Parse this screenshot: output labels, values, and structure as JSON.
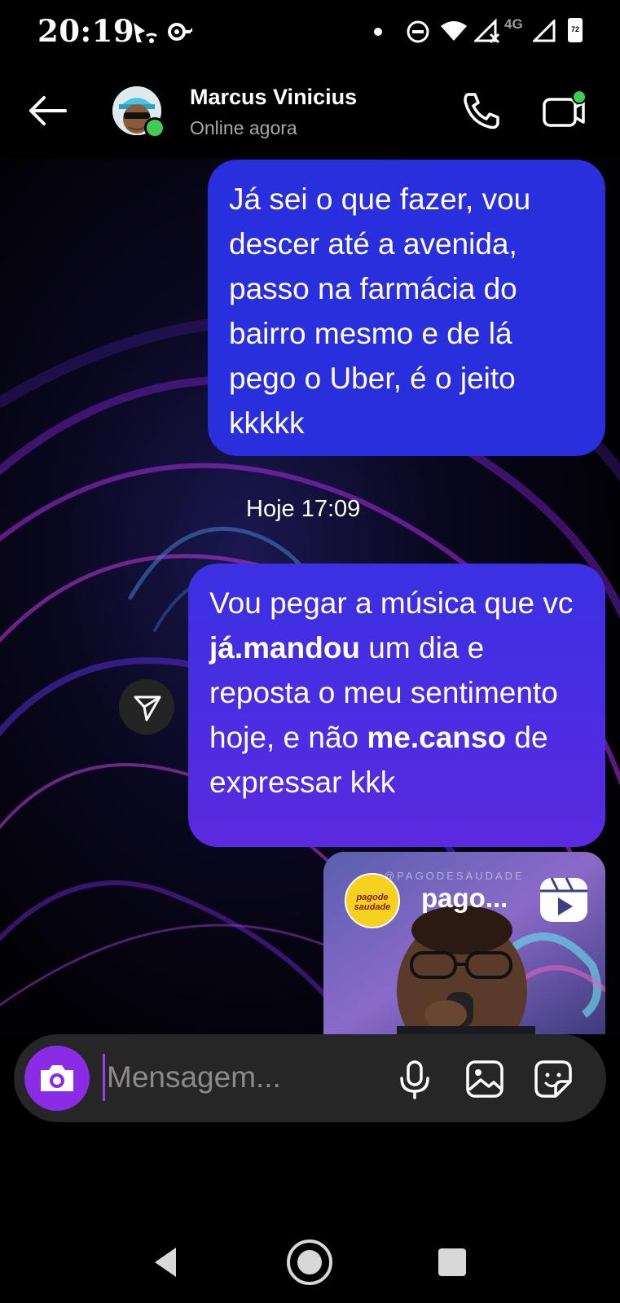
{
  "status_bar": {
    "time": "20:19",
    "network": "4G",
    "battery": "72",
    "icons": [
      "media-cast-icon",
      "vpn-key-icon",
      "notification-dot-icon",
      "do-not-disturb-icon",
      "wifi-icon",
      "signal-no-data-icon",
      "signal-icon",
      "battery-icon"
    ]
  },
  "header": {
    "contact_name": "Marcus Vinicius",
    "status": "Online agora",
    "icons": [
      "back-arrow-icon",
      "phone-icon",
      "video-call-icon"
    ]
  },
  "messages": [
    {
      "type": "sent",
      "segments": [
        {
          "text": "Já sei o que fazer, vou descer até a avenida, passo na farmácia do bairro mesmo e de lá pego o Uber, é o jeito kkkkk",
          "bold": false
        }
      ]
    },
    {
      "type": "timestamp",
      "text": "Hoje 17:09"
    },
    {
      "type": "sent",
      "segments": [
        {
          "text": "Vou pegar a música que vc ",
          "bold": false
        },
        {
          "text": "já.mandou",
          "bold": true
        },
        {
          "text": " um dia e reposta o meu sentimento hoje, e não ",
          "bold": false
        },
        {
          "text": "me.canso",
          "bold": true
        },
        {
          "text": " de expressar kkk",
          "bold": false
        }
      ]
    },
    {
      "type": "shared_reel",
      "handle": "@PAGODESAUDADE",
      "title": "pago...",
      "logo_text": "pagode saudade"
    }
  ],
  "composer": {
    "placeholder": "Mensagem...",
    "value": "",
    "icons": [
      "camera-icon",
      "microphone-icon",
      "gallery-icon",
      "sticker-icon"
    ]
  },
  "colors": {
    "bubble_blue": "#2a2fdd",
    "bubble_purple": "#5a2ae0",
    "camera_button": "#8a2be6",
    "online_green": "#3fcc54"
  },
  "nav_bar": {
    "icons": [
      "nav-back-icon",
      "nav-home-icon",
      "nav-recents-icon"
    ]
  }
}
